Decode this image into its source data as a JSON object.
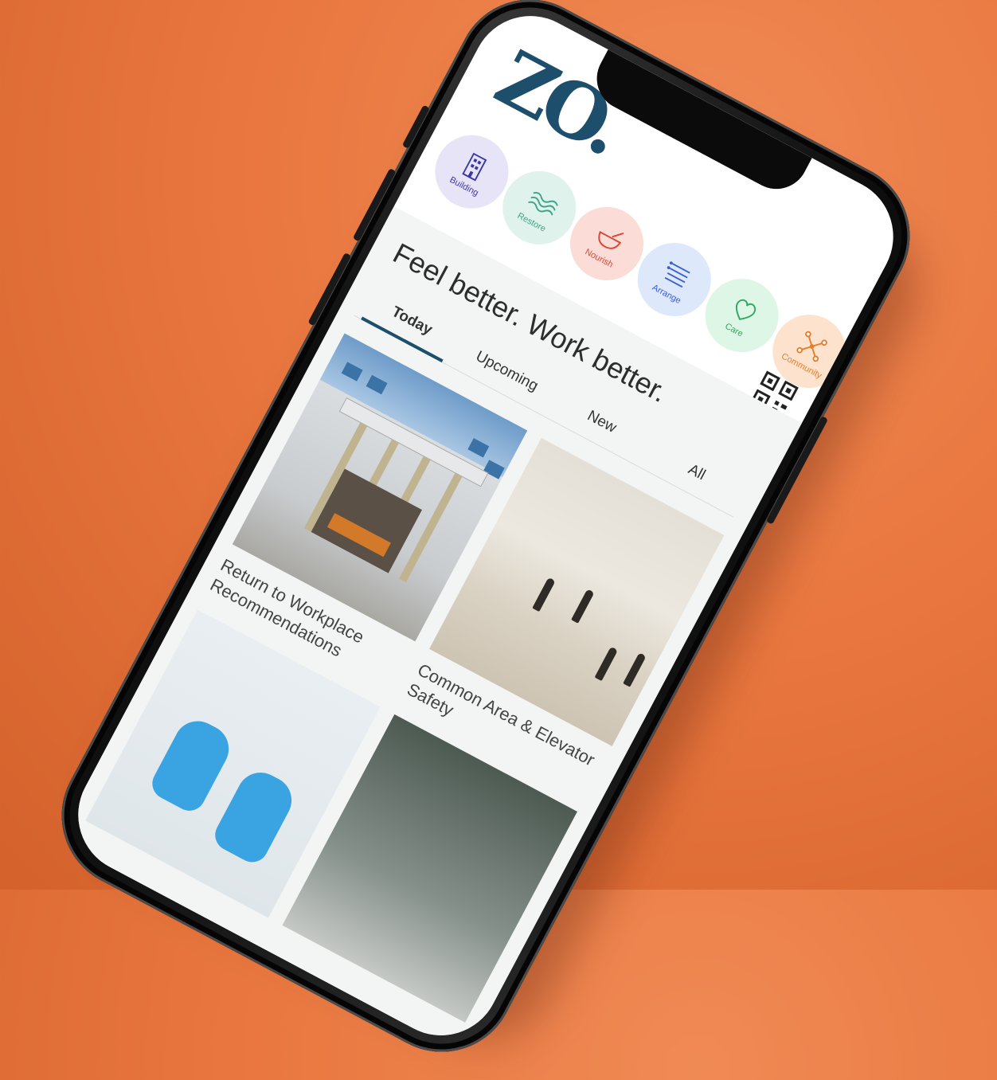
{
  "app": {
    "logo_text": "ZO.",
    "headline": "Feel better. Work better."
  },
  "categories": [
    {
      "label": "Building",
      "icon": "building-icon",
      "bg": "#e7e4f7",
      "fg": "#3a38a8"
    },
    {
      "label": "Restore",
      "icon": "waves-icon",
      "bg": "#dff2ec",
      "fg": "#3fa387"
    },
    {
      "label": "Nourish",
      "icon": "bowl-icon",
      "bg": "#fbdcd6",
      "fg": "#d9463a"
    },
    {
      "label": "Arrange",
      "icon": "list-icon",
      "bg": "#dde8fb",
      "fg": "#3a5fd0"
    },
    {
      "label": "Care",
      "icon": "heart-icon",
      "bg": "#def6e6",
      "fg": "#2ea860"
    },
    {
      "label": "Community",
      "icon": "network-icon",
      "bg": "#fde3cd",
      "fg": "#e57d2a"
    }
  ],
  "qr_icon": "qr-code-icon",
  "tabs": [
    {
      "label": "Today",
      "active": true
    },
    {
      "label": "Upcoming",
      "active": false
    },
    {
      "label": "New",
      "active": false
    },
    {
      "label": "All",
      "active": false
    }
  ],
  "cards": [
    {
      "title": "Return to Workplace Recommendations",
      "image": "building-entrance-photo"
    },
    {
      "title": "Common Area & Elevator Safety",
      "image": "lobby-hall-photo"
    },
    {
      "title": "",
      "image": "blue-gloves-thumbs-up-photo"
    },
    {
      "title": "",
      "image": "lab-equipment-photo"
    }
  ],
  "colors": {
    "background": "#e9773f",
    "brand": "#1d4e6c",
    "tab_underline": "#1d4e6c"
  }
}
